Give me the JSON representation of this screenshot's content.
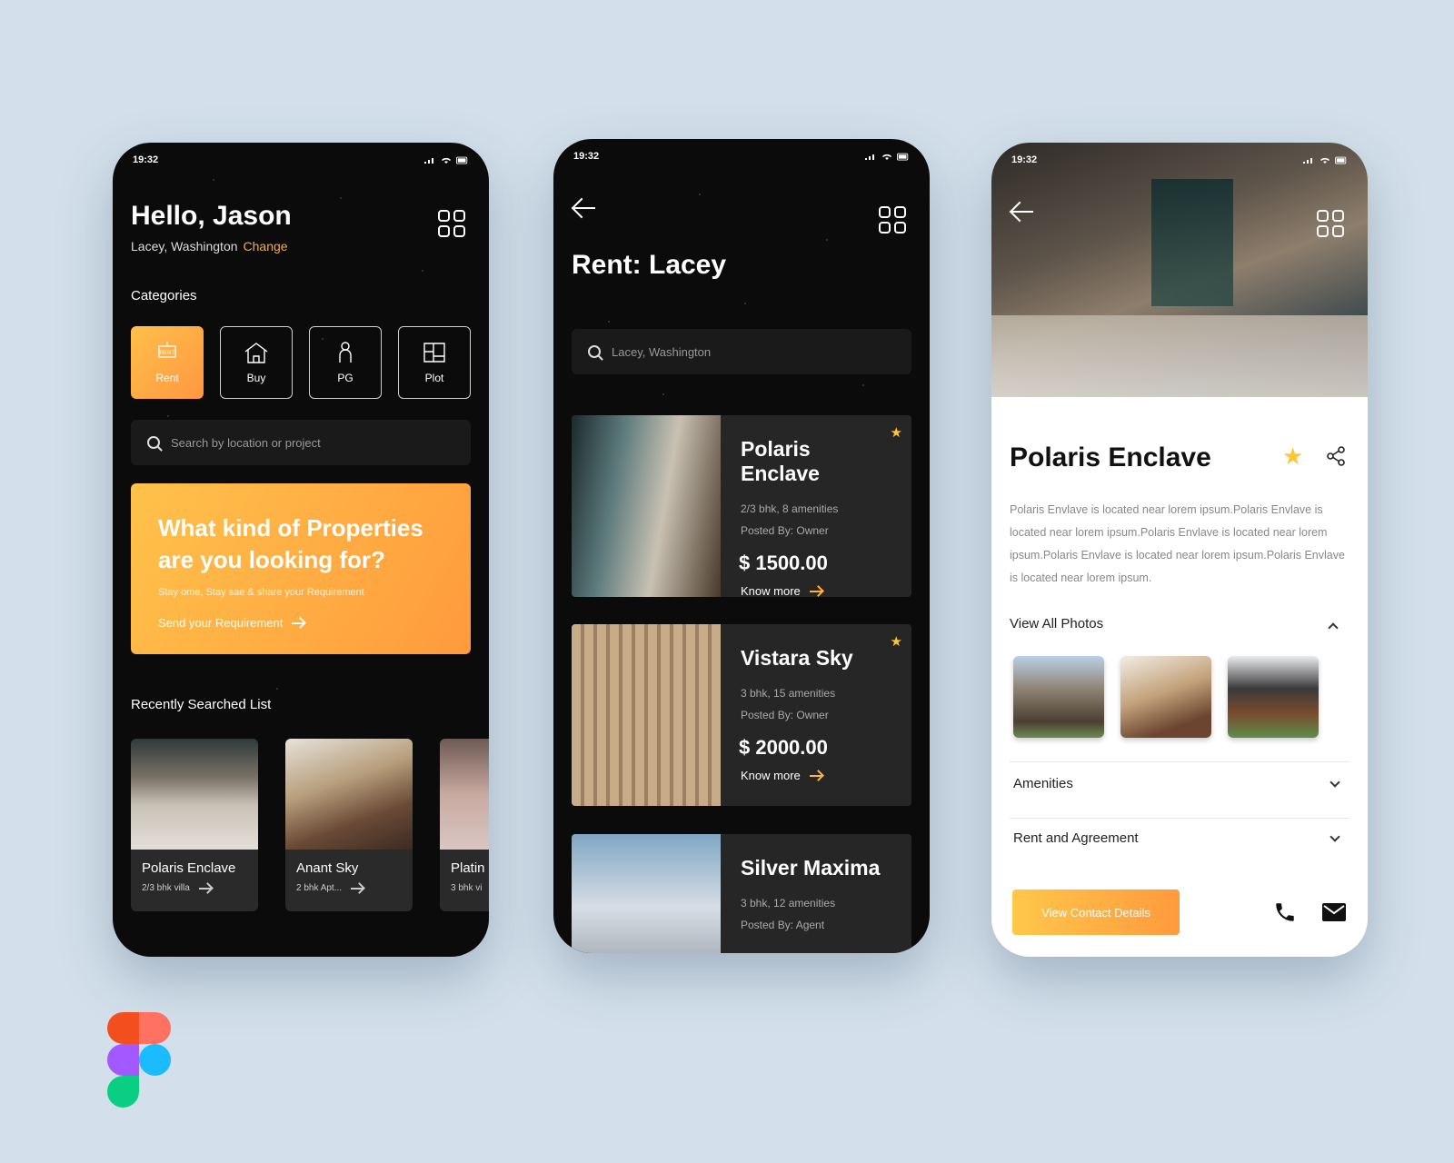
{
  "status": {
    "time": "19:32"
  },
  "home": {
    "greeting": "Hello, Jason",
    "location": "Lacey, Washington",
    "change_label": "Change",
    "categories_title": "Categories",
    "categories": [
      {
        "label": "Rent",
        "icon": "rent-sign-icon",
        "active": true
      },
      {
        "label": "Buy",
        "icon": "house-icon",
        "active": false
      },
      {
        "label": "PG",
        "icon": "person-icon",
        "active": false
      },
      {
        "label": "Plot",
        "icon": "plot-map-icon",
        "active": false
      }
    ],
    "search_placeholder": "Search by location or project",
    "promo": {
      "heading_line1": "What kind of Properties",
      "heading_line2": "are you looking for?",
      "subtitle": "Stay ome, Stay sae & share your Requirement",
      "link": "Send your Requirement"
    },
    "recent_title": "Recently Searched List",
    "recent": [
      {
        "name": "Polaris Enclave",
        "detail": "2/3 bhk villa"
      },
      {
        "name": "Anant Sky",
        "detail": "2 bhk Apt..."
      },
      {
        "name": "Platin",
        "detail": "3 bhk vi"
      }
    ]
  },
  "listing": {
    "title": "Rent: Lacey",
    "search_value": "Lacey, Washington",
    "know_more": "Know more",
    "items": [
      {
        "name": "Polaris Enclave",
        "detail": "2/3 bhk, 8 amenities",
        "posted": "Posted By: Owner",
        "price": "$ 1500.00",
        "starred": true
      },
      {
        "name": "Vistara Sky",
        "detail": "3 bhk, 15 amenities",
        "posted": "Posted By: Owner",
        "price": "$ 2000.00",
        "starred": true
      },
      {
        "name": "Silver Maxima",
        "detail": "3 bhk, 12 amenities",
        "posted": "Posted By: Agent",
        "price": "",
        "starred": false
      }
    ]
  },
  "detail": {
    "title": "Polaris Enclave",
    "description": "Polaris Envlave is located near lorem ipsum.Polaris Envlave is located near lorem ipsum.Polaris Envlave is located near lorem ipsum.Polaris Envlave is located near lorem ipsum.Polaris Envlave is located near lorem ipsum.",
    "photos_label": "View All Photos",
    "amenities_label": "Amenities",
    "rent_label": "Rent and Agreement",
    "contact_button": "View Contact Details"
  },
  "colors": {
    "accent": "#ffa93a",
    "star": "#ffc534",
    "dark_bg": "#0b0b0c",
    "card_bg": "#262627"
  }
}
